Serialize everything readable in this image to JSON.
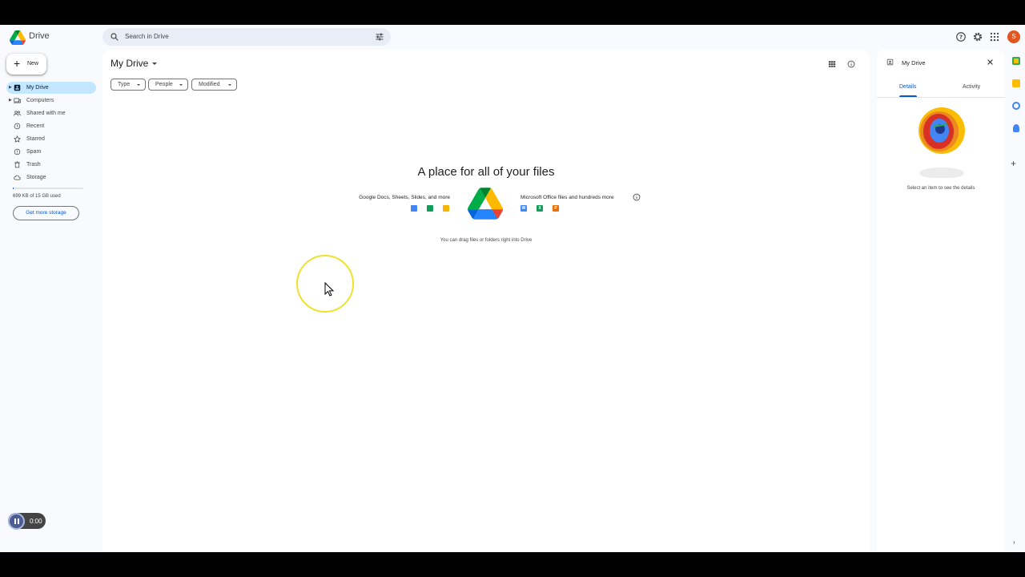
{
  "app": {
    "name": "Drive"
  },
  "search": {
    "placeholder": "Search in Drive"
  },
  "account": {
    "initial": "S",
    "color": "#e1551f"
  },
  "sidebar": {
    "new_label": "New",
    "items": [
      {
        "label": "My Drive",
        "icon": "my-drive-icon",
        "active": true,
        "expandable": true
      },
      {
        "label": "Computers",
        "icon": "computers-icon",
        "expandable": true
      },
      {
        "label": "Shared with me",
        "icon": "shared-icon"
      },
      {
        "label": "Recent",
        "icon": "clock-icon"
      },
      {
        "label": "Starred",
        "icon": "star-icon"
      },
      {
        "label": "Spam",
        "icon": "spam-icon"
      },
      {
        "label": "Trash",
        "icon": "trash-icon"
      },
      {
        "label": "Storage",
        "icon": "cloud-icon"
      }
    ],
    "storage_used": "699 KB of 15 GB used",
    "storage_fraction": 0.0001,
    "get_storage_label": "Get more storage"
  },
  "main": {
    "title": "My Drive",
    "filters": [
      {
        "label": "Type"
      },
      {
        "label": "People"
      },
      {
        "label": "Modified"
      }
    ],
    "empty_state": {
      "heading": "A place for all of your files",
      "google_text": "Google Docs, Sheets, Slides, and more",
      "ms_text": "Microsoft Office files and hundreds more",
      "drag_hint": "You can drag files or folders right into Drive",
      "google_icons": [
        {
          "name": "docs-icon",
          "color": "#4285f4"
        },
        {
          "name": "sheets-icon",
          "color": "#0f9d58"
        },
        {
          "name": "slides-icon",
          "color": "#f4b400"
        }
      ],
      "ms_icons": [
        {
          "letter": "W",
          "color": "#4285f4"
        },
        {
          "letter": "X",
          "color": "#0f9d58"
        },
        {
          "letter": "P",
          "color": "#e8710a"
        }
      ]
    }
  },
  "details": {
    "title": "My Drive",
    "tabs": [
      "Details",
      "Activity"
    ],
    "active_tab": "Details",
    "empty_text": "Select an item to see the details"
  },
  "recorder": {
    "time": "0:00"
  },
  "colors": {
    "accent": "#0b57d0",
    "active_nav": "#c2e7ff",
    "background": "#f8fafd"
  }
}
